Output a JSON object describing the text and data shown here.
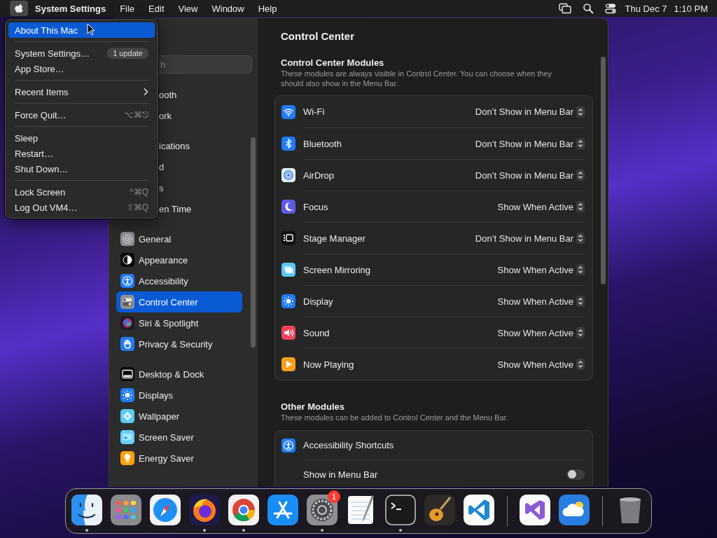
{
  "menu_bar": {
    "apple_menu_open": true,
    "app_name": "System Settings",
    "menus": [
      "File",
      "Edit",
      "View",
      "Window",
      "Help"
    ],
    "date": "Thu Dec 7",
    "time": "1:10 PM"
  },
  "apple_menu": {
    "items": [
      {
        "kind": "item",
        "label": "About This Mac",
        "selected": true
      },
      {
        "kind": "separator"
      },
      {
        "kind": "item",
        "label": "System Settings…",
        "badge": "1 update",
        "selected": false
      },
      {
        "kind": "item",
        "label": "App Store…",
        "selected": false
      },
      {
        "kind": "separator"
      },
      {
        "kind": "submenu",
        "label": "Recent Items",
        "selected": false
      },
      {
        "kind": "separator"
      },
      {
        "kind": "item",
        "label": "Force Quit…",
        "shortcut": "⌥⌘⎋",
        "selected": false
      },
      {
        "kind": "separator"
      },
      {
        "kind": "item",
        "label": "Sleep",
        "selected": false
      },
      {
        "kind": "item",
        "label": "Restart…",
        "selected": false
      },
      {
        "kind": "item",
        "label": "Shut Down…",
        "selected": false
      },
      {
        "kind": "separator"
      },
      {
        "kind": "item",
        "label": "Lock Screen",
        "shortcut": "^⌘Q",
        "selected": false
      },
      {
        "kind": "item",
        "label": "Log Out VM4…",
        "shortcut": "⇧⌘Q",
        "selected": false
      }
    ]
  },
  "sidebar": {
    "search": {
      "placeholder": "h"
    },
    "groups": [
      {
        "items": [
          {
            "kind": "covered",
            "label": "ooth",
            "selected": false
          },
          {
            "kind": "covered",
            "label": "ork",
            "selected": false
          }
        ]
      },
      {
        "items": [
          {
            "kind": "covered",
            "label": "ications",
            "selected": false
          },
          {
            "kind": "covered",
            "label": "d",
            "selected": false
          },
          {
            "kind": "covered",
            "label": "s",
            "selected": false
          },
          {
            "kind": "covered",
            "label": "en Time",
            "selected": false
          }
        ]
      },
      {
        "items": [
          {
            "kind": "full",
            "label": "General",
            "selected": false
          },
          {
            "kind": "full",
            "label": "Appearance",
            "selected": false
          },
          {
            "kind": "full",
            "label": "Accessibility",
            "selected": false
          },
          {
            "kind": "full",
            "label": "Control Center",
            "selected": true
          },
          {
            "kind": "full",
            "label": "Siri & Spotlight",
            "selected": false
          },
          {
            "kind": "full",
            "label": "Privacy & Security",
            "selected": false
          }
        ]
      },
      {
        "items": [
          {
            "kind": "full",
            "label": "Desktop & Dock",
            "selected": false
          },
          {
            "kind": "full",
            "label": "Displays",
            "selected": false
          },
          {
            "kind": "full",
            "label": "Wallpaper",
            "selected": false
          },
          {
            "kind": "full",
            "label": "Screen Saver",
            "selected": false
          },
          {
            "kind": "full",
            "label": "Energy Saver",
            "selected": false
          }
        ]
      }
    ]
  },
  "pane": {
    "title": "Control Center",
    "sections": [
      {
        "heading": "Control Center Modules",
        "description": "These modules are always visible in Control Center. You can choose when they should also show in the Menu Bar.",
        "rows": [
          {
            "kind": "popup",
            "label": "Wi-Fi",
            "value": "Don’t Show in Menu Bar"
          },
          {
            "kind": "popup",
            "label": "Bluetooth",
            "value": "Don’t Show in Menu Bar"
          },
          {
            "kind": "popup",
            "label": "AirDrop",
            "value": "Don’t Show in Menu Bar"
          },
          {
            "kind": "popup",
            "label": "Focus",
            "value": "Show When Active"
          },
          {
            "kind": "popup",
            "label": "Stage Manager",
            "value": "Don’t Show in Menu Bar"
          },
          {
            "kind": "popup",
            "label": "Screen Mirroring",
            "value": "Show When Active"
          },
          {
            "kind": "popup",
            "label": "Display",
            "value": "Show When Active"
          },
          {
            "kind": "popup",
            "label": "Sound",
            "value": "Show When Active"
          },
          {
            "kind": "popup",
            "label": "Now Playing",
            "value": "Show When Active"
          }
        ]
      },
      {
        "heading": "Other Modules",
        "description": "These modules can be added to Control Center and the Menu Bar.",
        "rows": [
          {
            "kind": "module",
            "label": "Accessibility Shortcuts"
          },
          {
            "kind": "toggle",
            "label": "Show in Menu Bar",
            "on": false
          }
        ]
      }
    ]
  },
  "dock": {
    "items": [
      {
        "kind": "app",
        "running": true
      },
      {
        "kind": "app",
        "running": false
      },
      {
        "kind": "app",
        "running": false
      },
      {
        "kind": "app",
        "running": true
      },
      {
        "kind": "app",
        "running": true
      },
      {
        "kind": "app",
        "running": false
      },
      {
        "kind": "app",
        "running": true,
        "badge": "1"
      },
      {
        "kind": "app",
        "running": false
      },
      {
        "kind": "app",
        "running": true
      },
      {
        "kind": "app",
        "running": false
      },
      {
        "kind": "app",
        "running": false
      },
      {
        "kind": "separator"
      },
      {
        "kind": "app",
        "running": false
      },
      {
        "kind": "app",
        "running": false
      },
      {
        "kind": "separator"
      },
      {
        "kind": "app",
        "running": false
      }
    ]
  }
}
